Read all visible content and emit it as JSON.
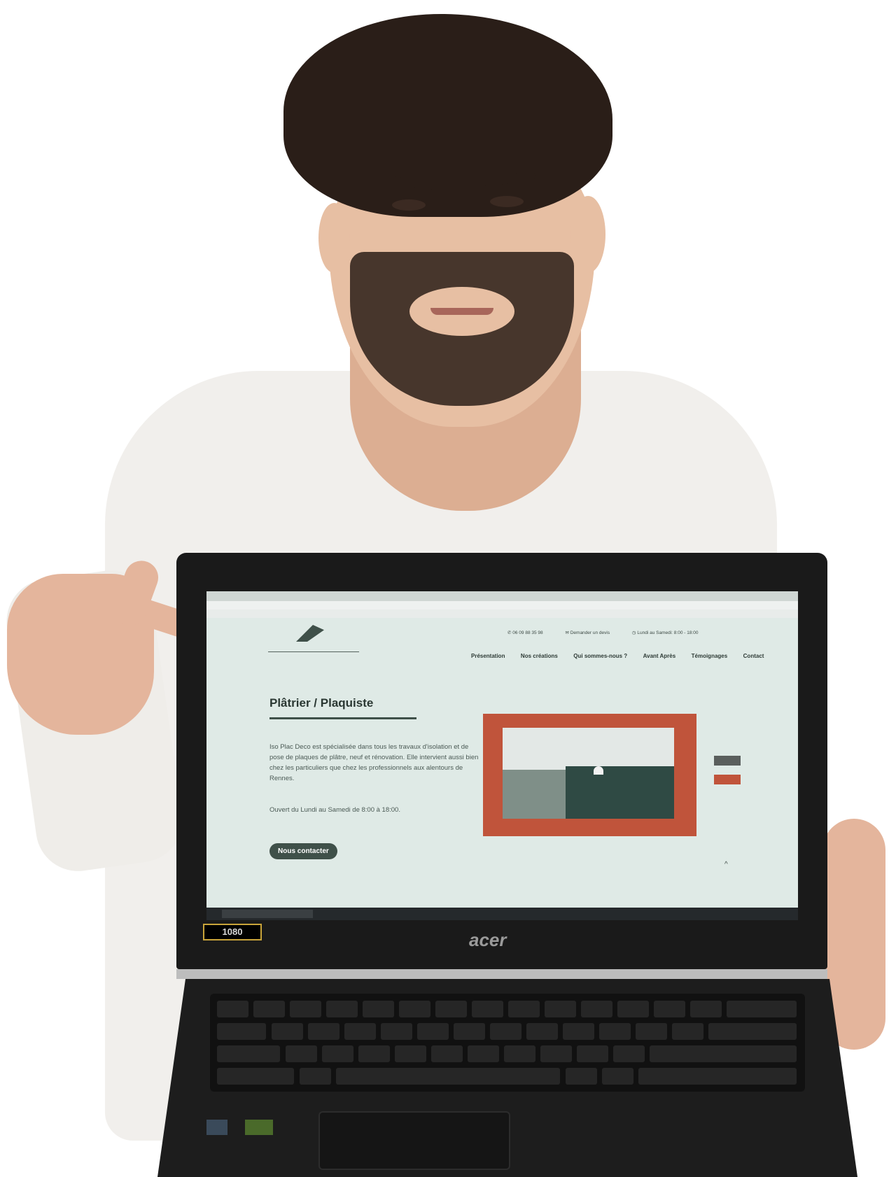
{
  "laptop": {
    "brand": "acer",
    "sticker": "1080"
  },
  "site": {
    "phone": "06 09 88 35 98",
    "email": "Demander un devis",
    "hours": "Lundi au Samedi: 8:00 - 18:00",
    "nav": [
      "Présentation",
      "Nos créations",
      "Qui sommes-nous ?",
      "Avant Après",
      "Témoignages",
      "Contact"
    ],
    "title": "Plâtrier / Plaquiste",
    "paragraph_1": "Iso Plac Deco est spécialisée dans tous les travaux d'isolation et de pose de plaques de plâtre, neuf et rénovation. Elle intervient aussi bien chez les particuliers que chez les professionnels aux alentours de Rennes.",
    "paragraph_2": "Ouvert du Lundi au Samedi de 8:00 à 18:00.",
    "cta": "Nous contacter"
  },
  "colors": {
    "accent": "#3f5049",
    "frame": "#c0543b",
    "page_bg": "#dfeae6"
  }
}
